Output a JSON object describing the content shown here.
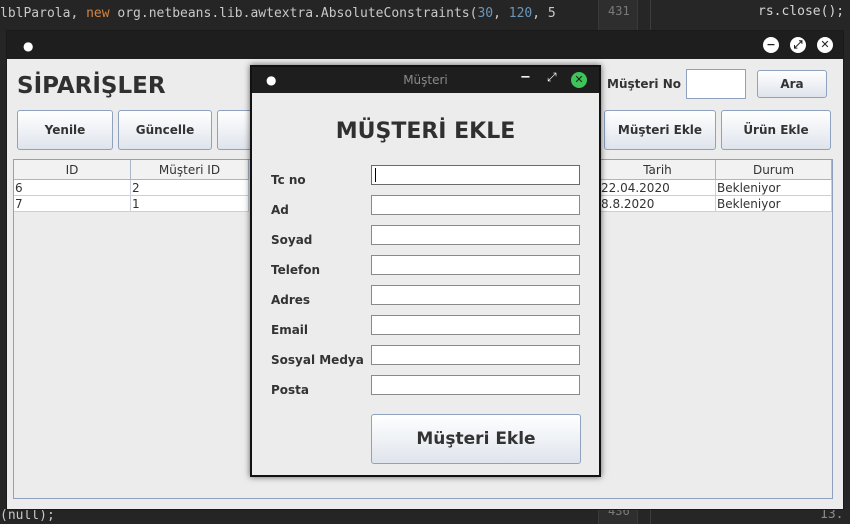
{
  "ide": {
    "code_top_parts": [
      "lblParola, ",
      "new",
      " org.netbeans.lib.awtextra.AbsoluteConstraints(",
      "30",
      ", ",
      "120",
      ", 5"
    ],
    "code_bottom": "(null);",
    "line_top": "431",
    "line_bottom": "436",
    "right_top": "rs.close();",
    "right_bottom": "13."
  },
  "main_window": {
    "title_dot": "●",
    "title": "SİPARİŞLER",
    "buttons": {
      "refresh": "Yenile",
      "update": "Güncelle",
      "add_customer": "Müşteri Ekle",
      "add_product": "Ürün Ekle",
      "search": "Ara"
    },
    "customer_no_label": "Müşteri No",
    "customer_no_value": "",
    "table": {
      "columns": [
        "ID",
        "Müşteri ID",
        "Tarih",
        "Durum"
      ],
      "rows": [
        {
          "id": "6",
          "customer_id": "2",
          "date": "22.04.2020",
          "status": "Bekleniyor"
        },
        {
          "id": "7",
          "customer_id": "1",
          "date": "8.8.2020",
          "status": "Bekleniyor"
        }
      ]
    }
  },
  "dialog": {
    "title": "Müşteri",
    "heading": "MÜŞTERİ EKLE",
    "fields": [
      {
        "label": "Tc no",
        "value": ""
      },
      {
        "label": "Ad",
        "value": ""
      },
      {
        "label": "Soyad",
        "value": ""
      },
      {
        "label": "Telefon",
        "value": ""
      },
      {
        "label": "Adres",
        "value": ""
      },
      {
        "label": "Email",
        "value": ""
      },
      {
        "label": "Sosyal Medya",
        "value": ""
      },
      {
        "label": "Posta",
        "value": ""
      }
    ],
    "submit": "Müşteri Ekle"
  }
}
